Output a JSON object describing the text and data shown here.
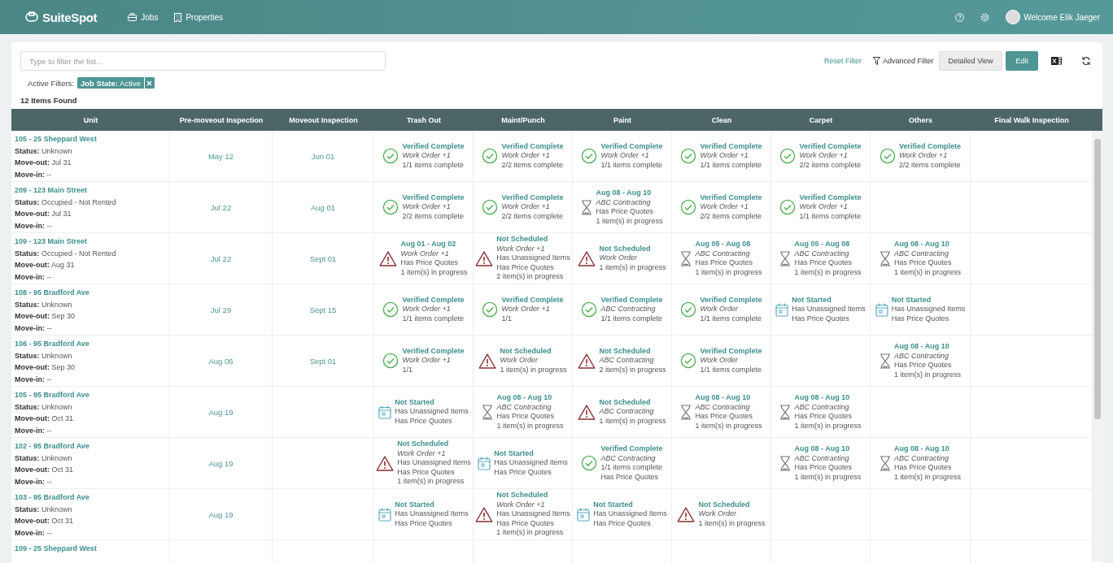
{
  "header": {
    "brand": "SuiteSpot",
    "nav": [
      {
        "label": "Jobs"
      },
      {
        "label": "Properties"
      }
    ],
    "welcome": "Welcome Elik Jaeger"
  },
  "toolbar": {
    "filter_placeholder": "Type to filter the list...",
    "reset": "Reset Filter",
    "advanced": "Advanced Filter",
    "views": [
      {
        "label": "Detailed View",
        "selected": true
      }
    ],
    "edit": "Edit"
  },
  "active_filters": {
    "label": "Active Filters:",
    "chips": [
      "**Job State:** Active"
    ]
  },
  "count": "12 Items Found",
  "table": {
    "columns": [
      "Unit",
      "Pre-moveout Inspection",
      "Moveout Inspection",
      "Trash Out",
      "Maint/Punch",
      "Paint",
      "Clean",
      "Carpet",
      "Others",
      "Final Walk Inspection"
    ],
    "rows": [
      {
        "unit": "105 - 25 Sheppard West",
        "details": [
          "**Status:** Unknown",
          "**Move-out:** Jul 31",
          "**Move-in:** --"
        ],
        "pre_moveout": "May 12",
        "moveout": "Jun 01",
        "tasks": [
          {
            "kind": "complete",
            "title": "Verified Complete",
            "vendor": "Work Order +1",
            "lines": [
              "1/1 items complete"
            ]
          },
          {
            "kind": "complete",
            "title": "Verified Complete",
            "vendor": "Work Order +1",
            "lines": [
              "2/2 items complete"
            ]
          },
          {
            "kind": "complete",
            "title": "Verified Complete",
            "vendor": "Work Order +1",
            "lines": [
              "1/1 items complete"
            ]
          },
          {
            "kind": "complete",
            "title": "Verified Complete",
            "vendor": "Work Order +1",
            "lines": [
              "1/1 items complete"
            ]
          },
          {
            "kind": "complete",
            "title": "Verified Complete",
            "vendor": "Work Order +1",
            "lines": [
              "2/2 items complete"
            ]
          },
          {
            "kind": "complete",
            "title": "Verified Complete",
            "vendor": "Work Order +1",
            "lines": [
              "2/2 items complete"
            ]
          }
        ]
      },
      {
        "unit": "209 - 123 Main Street",
        "details": [
          "**Status:** Occupied - Not Rented",
          "**Move-out:** Jul 31",
          "**Move-in:** --"
        ],
        "pre_moveout": "Jul 22",
        "moveout": "Aug 01",
        "tasks": [
          {
            "kind": "complete",
            "title": "Verified Complete",
            "vendor": "Work Order +1",
            "lines": [
              "2/2 items complete"
            ]
          },
          {
            "kind": "complete",
            "title": "Verified Complete",
            "vendor": "Work Order +1",
            "lines": [
              "2/2 items complete"
            ]
          },
          {
            "kind": "scheduled",
            "title": "Aug 08 - Aug 10",
            "vendor": "ABC Contracting",
            "lines": [
              "Has Price Quotes",
              "1 item(s) in progress"
            ]
          },
          {
            "kind": "complete",
            "title": "Verified Complete",
            "vendor": "Work Order +1",
            "lines": [
              "2/2 items complete"
            ]
          },
          {
            "kind": "complete",
            "title": "Verified Complete",
            "vendor": "Work Order +1",
            "lines": [
              "1/1 items complete"
            ]
          }
        ]
      },
      {
        "unit": "109 - 123 Main Street",
        "details": [
          "**Status:** Occupied - Not Rented",
          "**Move-out:** Aug 31",
          "**Move-in:** --"
        ],
        "pre_moveout": "Jul 22",
        "moveout": "Sept 01",
        "tasks": [
          {
            "kind": "warning",
            "title": "Aug 01 - Aug 02",
            "vendor": "Work Order +1",
            "lines": [
              "Has Price Quotes",
              "1 item(s) in progress"
            ]
          },
          {
            "kind": "warning",
            "title": "Not Scheduled",
            "vendor": "Work Order +1",
            "lines": [
              "Has Unassigned Items",
              "Has Price Quotes",
              "2 item(s) in progress"
            ]
          },
          {
            "kind": "warning",
            "title": "Not Scheduled",
            "vendor": "Work Order",
            "lines": [
              "1 item(s) in progress"
            ]
          },
          {
            "kind": "scheduled",
            "title": "Aug 05 - Aug 08",
            "vendor": "ABC Contracting",
            "lines": [
              "Has Price Quotes",
              "1 item(s) in progress"
            ]
          },
          {
            "kind": "scheduled",
            "title": "Aug 05 - Aug 08",
            "vendor": "ABC Contracting",
            "lines": [
              "Has Price Quotes",
              "1 item(s) in progress"
            ]
          },
          {
            "kind": "scheduled",
            "title": "Aug 08 - Aug 10",
            "vendor": "ABC Contracting",
            "lines": [
              "Has Price Quotes",
              "1 item(s) in progress"
            ]
          }
        ]
      },
      {
        "unit": "108 - 95 Bradford Ave",
        "details": [
          "**Status:** Unknown",
          "**Move-out:** Sep 30",
          "**Move-in:** --"
        ],
        "pre_moveout": "Jul 29",
        "moveout": "Sept 15",
        "tasks": [
          {
            "kind": "complete",
            "title": "Verified Complete",
            "vendor": "Work Order +1",
            "lines": [
              "1/1 items complete"
            ]
          },
          {
            "kind": "complete",
            "title": "Verified Complete",
            "vendor": "Work Order +1",
            "lines": [
              "1/1"
            ]
          },
          {
            "kind": "complete",
            "title": "Verified Complete",
            "vendor": "ABC Contracting",
            "lines": [
              "1/1 items complete"
            ]
          },
          {
            "kind": "complete",
            "title": "Verified Complete",
            "vendor": "Work Order",
            "lines": [
              "1/1 items complete"
            ]
          },
          {
            "kind": "not_started",
            "title": "Not Started",
            "lines": [
              "Has Unassigned Items",
              "Has Price Quotes"
            ]
          },
          {
            "kind": "not_started",
            "title": "Not Started",
            "lines": [
              "Has Unassigned Items",
              "Has Price Quotes"
            ]
          }
        ]
      },
      {
        "unit": "106 - 95 Bradford Ave",
        "details": [
          "**Status:** Unknown",
          "**Move-out:** Sep 30",
          "**Move-in:** --"
        ],
        "pre_moveout": "Aug 06",
        "moveout": "Sept 01",
        "tasks": [
          {
            "kind": "complete",
            "title": "Verified Complete",
            "vendor": "Work Order +1",
            "lines": [
              "1/1"
            ]
          },
          {
            "kind": "warning",
            "title": "Not Scheduled",
            "vendor": "Work Order",
            "lines": [
              "1 item(s) in progress"
            ]
          },
          {
            "kind": "warning",
            "title": "Not Scheduled",
            "vendor": "ABC Contracting",
            "lines": [
              "2 item(s) in progress"
            ]
          },
          {
            "kind": "complete",
            "title": "Verified Complete",
            "vendor": "Work Order",
            "lines": [
              "1/1 items complete"
            ]
          },
          {
            "kind": "empty"
          },
          {
            "kind": "scheduled",
            "title": "Aug 08 - Aug 10",
            "vendor": "ABC Contracting",
            "lines": [
              "Has Price Quotes",
              "1 item(s) in progress"
            ]
          }
        ]
      },
      {
        "unit": "105 - 95 Bradford Ave",
        "details": [
          "**Status:** Unknown",
          "**Move-out:** Oct 31",
          "**Move-in:** --"
        ],
        "pre_moveout": "Aug 19",
        "tasks": [
          {
            "kind": "not_started",
            "title": "Not Started",
            "lines": [
              "Has Unassigned Items",
              "Has Price Quotes"
            ]
          },
          {
            "kind": "scheduled",
            "title": "Aug 08 - Aug 10",
            "vendor": "ABC Contracting",
            "lines": [
              "Has Price Quotes",
              "1 item(s) in progress"
            ]
          },
          {
            "kind": "warning",
            "title": "Not Scheduled",
            "vendor": "ABC Contracting",
            "lines": [
              "1 item(s) in progress"
            ]
          },
          {
            "kind": "scheduled",
            "title": "Aug 08 - Aug 10",
            "vendor": "ABC Contracting",
            "lines": [
              "Has Price Quotes",
              "1 item(s) in progress"
            ]
          },
          {
            "kind": "scheduled",
            "title": "Aug 08 - Aug 10",
            "vendor": "ABC Contracting",
            "lines": [
              "Has Price Quotes",
              "1 item(s) in progress"
            ]
          }
        ]
      },
      {
        "unit": "102 - 95 Bradford Ave",
        "details": [
          "**Status:** Unknown",
          "**Move-out:** Oct 31",
          "**Move-in:** --"
        ],
        "pre_moveout": "Aug 19",
        "tasks": [
          {
            "kind": "warning",
            "title": "Not Scheduled",
            "vendor": "Work Order +1",
            "lines": [
              "Has Unassigned Items",
              "Has Price Quotes",
              "1 item(s) in progress"
            ]
          },
          {
            "kind": "not_started",
            "title": "Not Started",
            "lines": [
              "Has Unassigned Items",
              "Has Price Quotes"
            ]
          },
          {
            "kind": "complete",
            "title": "Verified Complete",
            "vendor": "ABC Contracting",
            "lines": [
              "1/1 items complete",
              "Has Price Quotes"
            ]
          },
          {
            "kind": "empty"
          },
          {
            "kind": "scheduled",
            "title": "Aug 08 - Aug 10",
            "vendor": "ABC Contracting",
            "lines": [
              "Has Price Quotes",
              "1 item(s) in progress"
            ]
          },
          {
            "kind": "scheduled",
            "title": "Aug 08 - Aug 10",
            "vendor": "ABC Contracting",
            "lines": [
              "Has Price Quotes",
              "1 item(s) in progress"
            ]
          }
        ]
      },
      {
        "unit": "103 - 95 Bradford Ave",
        "details": [
          "**Status:** Unknown",
          "**Move-out:** Oct 31",
          "**Move-in:** --"
        ],
        "pre_moveout": "Aug 19",
        "tasks": [
          {
            "kind": "not_started",
            "title": "Not Started",
            "lines": [
              "Has Unassigned Items",
              "Has Price Quotes"
            ]
          },
          {
            "kind": "warning",
            "title": "Not Scheduled",
            "vendor": "Work Order +1",
            "lines": [
              "Has Unassigned Items",
              "Has Price Quotes",
              "1 item(s) in progress"
            ]
          },
          {
            "kind": "not_started",
            "title": "Not Started",
            "lines": [
              "Has Unassigned Items",
              "Has Price Quotes"
            ]
          },
          {
            "kind": "warning",
            "title": "Not Scheduled",
            "vendor": "Work Order",
            "lines": [
              "1 item(s) in progress"
            ]
          }
        ]
      },
      {
        "unit": "109 - 25 Sheppard West"
      }
    ]
  }
}
